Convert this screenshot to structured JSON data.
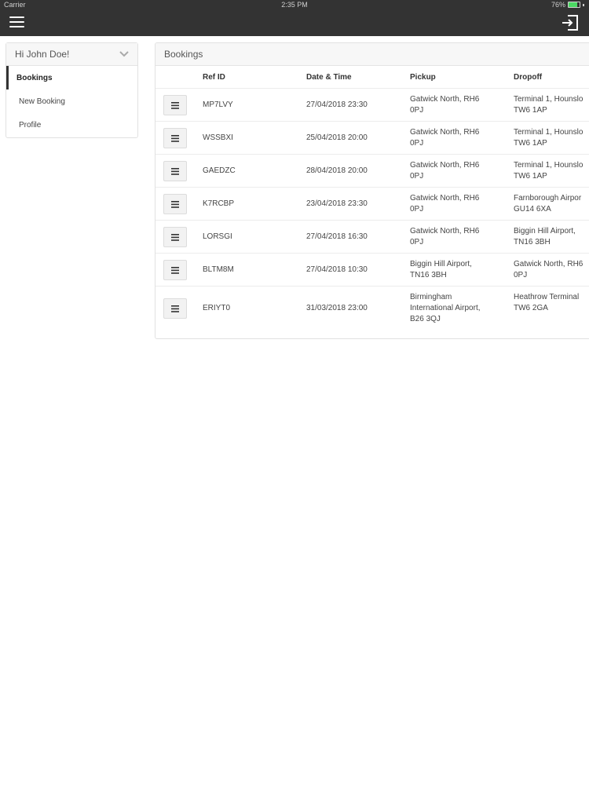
{
  "status_bar": {
    "carrier": "Carrier ",
    "time": "2:35 PM",
    "battery": "76%",
    "battery_level": 0.76
  },
  "header": {
    "menu_icon": "hamburger-icon",
    "logout_icon": "logout-icon"
  },
  "sidebar": {
    "greeting": "Hi John Doe!",
    "items": [
      {
        "label": "Bookings",
        "active": true
      },
      {
        "label": "New Booking",
        "active": false
      },
      {
        "label": "Profile",
        "active": false
      }
    ]
  },
  "bookings": {
    "title": "Bookings",
    "columns": [
      "Ref ID",
      "Date & Time",
      "Pickup",
      "Dropoff"
    ],
    "rows": [
      {
        "ref": "MP7LVY",
        "datetime": "27/04/2018 23:30",
        "pickup": "Gatwick North, RH6\n0PJ",
        "dropoff": "Terminal 1, Hounslo\nTW6 1AP"
      },
      {
        "ref": "WSSBXI",
        "datetime": "25/04/2018 20:00",
        "pickup": "Gatwick North, RH6\n0PJ",
        "dropoff": "Terminal 1, Hounslo\nTW6 1AP"
      },
      {
        "ref": "GAEDZC",
        "datetime": "28/04/2018 20:00",
        "pickup": "Gatwick North, RH6\n0PJ",
        "dropoff": "Terminal 1, Hounslo\nTW6 1AP"
      },
      {
        "ref": "K7RCBP",
        "datetime": "23/04/2018 23:30",
        "pickup": "Gatwick North, RH6\n0PJ",
        "dropoff": "Farnborough Airpor\nGU14 6XA"
      },
      {
        "ref": "LORSGI",
        "datetime": "27/04/2018 16:30",
        "pickup": "Gatwick North, RH6\n0PJ",
        "dropoff": "Biggin Hill Airport,\nTN16 3BH"
      },
      {
        "ref": "BLTM8M",
        "datetime": "27/04/2018 10:30",
        "pickup": "Biggin Hill Airport,\nTN16 3BH",
        "dropoff": "Gatwick North, RH6\n0PJ"
      },
      {
        "ref": "ERIYT0",
        "datetime": "31/03/2018 23:00",
        "pickup": "Birmingham\nInternational Airport,\nB26 3QJ",
        "dropoff": "Heathrow Terminal\nTW6 2GA"
      }
    ]
  }
}
